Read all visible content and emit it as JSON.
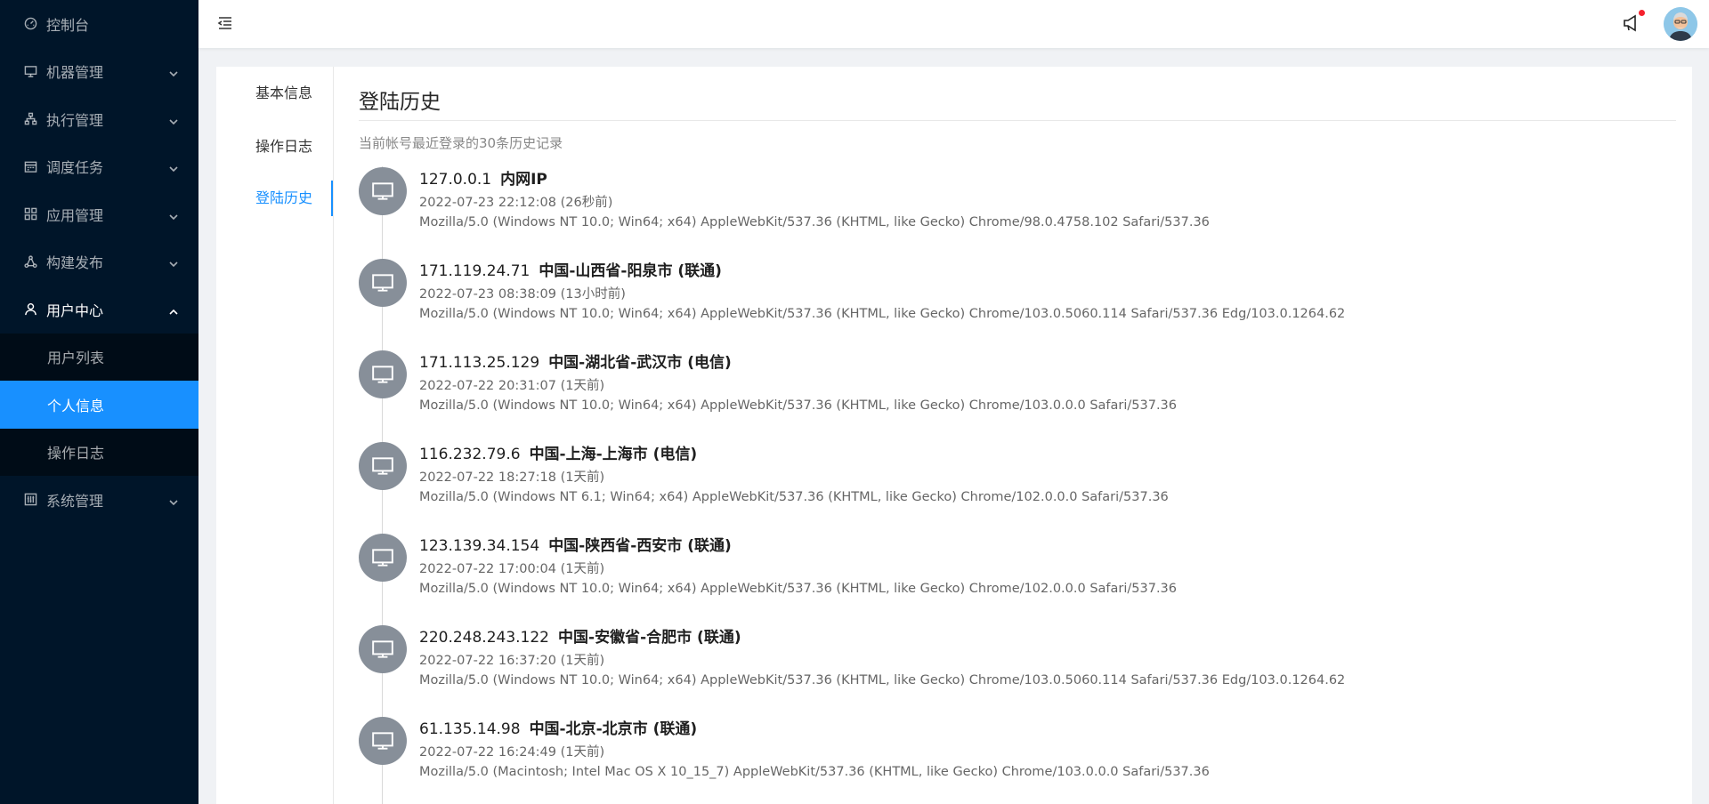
{
  "sidebar": {
    "items": [
      {
        "label": "控制台",
        "icon": "dashboard-icon"
      },
      {
        "label": "机器管理",
        "icon": "desktop-icon"
      },
      {
        "label": "执行管理",
        "icon": "cluster-icon"
      },
      {
        "label": "调度任务",
        "icon": "schedule-icon"
      },
      {
        "label": "应用管理",
        "icon": "appstore-icon"
      },
      {
        "label": "构建发布",
        "icon": "build-icon"
      },
      {
        "label": "用户中心",
        "icon": "user-icon"
      },
      {
        "label": "系统管理",
        "icon": "setting-icon"
      }
    ],
    "user_center_sub": [
      {
        "label": "用户列表"
      },
      {
        "label": "个人信息"
      },
      {
        "label": "操作日志"
      }
    ]
  },
  "tabs": [
    {
      "label": "基本信息"
    },
    {
      "label": "操作日志"
    },
    {
      "label": "登陆历史"
    }
  ],
  "page": {
    "title": "登陆历史",
    "subtitle": "当前帐号最近登录的30条历史记录"
  },
  "history": [
    {
      "ip": "127.0.0.1",
      "location": "内网IP",
      "time": "2022-07-23 22:12:08 (26秒前)",
      "ua": "Mozilla/5.0 (Windows NT 10.0; Win64; x64) AppleWebKit/537.36 (KHTML, like Gecko) Chrome/98.0.4758.102 Safari/537.36"
    },
    {
      "ip": "171.119.24.71",
      "location": "中国-山西省-阳泉市 (联通)",
      "time": "2022-07-23 08:38:09 (13小时前)",
      "ua": "Mozilla/5.0 (Windows NT 10.0; Win64; x64) AppleWebKit/537.36 (KHTML, like Gecko) Chrome/103.0.5060.114 Safari/537.36 Edg/103.0.1264.62"
    },
    {
      "ip": "171.113.25.129",
      "location": "中国-湖北省-武汉市 (电信)",
      "time": "2022-07-22 20:31:07 (1天前)",
      "ua": "Mozilla/5.0 (Windows NT 10.0; Win64; x64) AppleWebKit/537.36 (KHTML, like Gecko) Chrome/103.0.0.0 Safari/537.36"
    },
    {
      "ip": "116.232.79.6",
      "location": "中国-上海-上海市 (电信)",
      "time": "2022-07-22 18:27:18 (1天前)",
      "ua": "Mozilla/5.0 (Windows NT 6.1; Win64; x64) AppleWebKit/537.36 (KHTML, like Gecko) Chrome/102.0.0.0 Safari/537.36"
    },
    {
      "ip": "123.139.34.154",
      "location": "中国-陕西省-西安市 (联通)",
      "time": "2022-07-22 17:00:04 (1天前)",
      "ua": "Mozilla/5.0 (Windows NT 10.0; Win64; x64) AppleWebKit/537.36 (KHTML, like Gecko) Chrome/102.0.0.0 Safari/537.36"
    },
    {
      "ip": "220.248.243.122",
      "location": "中国-安徽省-合肥市 (联通)",
      "time": "2022-07-22 16:37:20 (1天前)",
      "ua": "Mozilla/5.0 (Windows NT 10.0; Win64; x64) AppleWebKit/537.36 (KHTML, like Gecko) Chrome/103.0.5060.114 Safari/537.36 Edg/103.0.1264.62"
    },
    {
      "ip": "61.135.14.98",
      "location": "中国-北京-北京市 (联通)",
      "time": "2022-07-22 16:24:49 (1天前)",
      "ua": "Mozilla/5.0 (Macintosh; Intel Mac OS X 10_15_7) AppleWebKit/537.36 (KHTML, like Gecko) Chrome/103.0.0.0 Safari/537.36"
    }
  ],
  "colors": {
    "sidebar_bg": "#001529",
    "accent": "#1890ff",
    "notify_dot": "#f5222d"
  }
}
